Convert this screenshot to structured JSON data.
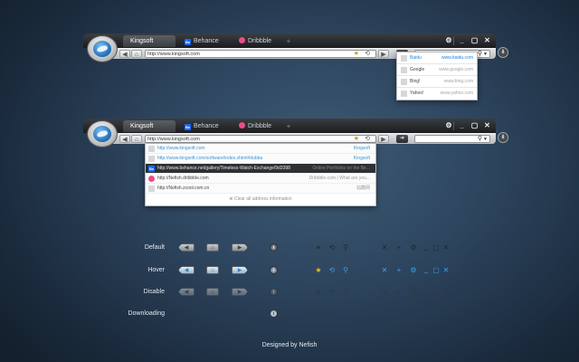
{
  "window1": {
    "tabs": [
      {
        "label": "Kingsoft",
        "icon": "",
        "active": true
      },
      {
        "label": "Behance",
        "icon": "Be",
        "active": false
      },
      {
        "label": "Dribbble",
        "icon": "",
        "active": false
      }
    ],
    "new_tab": "+",
    "controls": [
      "⚙",
      "_",
      "▢",
      "✕"
    ],
    "nav": {
      "back": "◀",
      "forward": "▶",
      "home": "⌂"
    },
    "address": "http://www.kingsoft.com",
    "go_label": "➔",
    "search_engines": [
      {
        "name": "Baidu",
        "url": "www.baidu.com",
        "selected": true
      },
      {
        "name": "Google",
        "url": "www.google.com",
        "selected": false
      },
      {
        "name": "Bing!",
        "url": "www.bing.com",
        "selected": false
      },
      {
        "name": "Yahoo!",
        "url": "www.yahoo.com",
        "selected": false
      }
    ]
  },
  "window2": {
    "tabs": [
      {
        "label": "Kingsoft",
        "icon": "",
        "active": true
      },
      {
        "label": "Behance",
        "icon": "Be",
        "active": false
      },
      {
        "label": "Dribbble",
        "icon": "",
        "active": false
      }
    ],
    "address": "http://www.kingsoft.com",
    "suggestions": [
      {
        "url": "http://www.kingsoft.com",
        "desc": "Kingsoft",
        "style": "blue",
        "icon": ""
      },
      {
        "url": "http://www.kingsoft.com/software/index.shtml#dubba",
        "desc": "Kingsoft",
        "style": "blue",
        "icon": ""
      },
      {
        "url": "http://www.behance.net/gallery/Timeless-Watch-Exchange/9d3398",
        "desc": "Online Portfolios on the Be...",
        "style": "hl",
        "icon": "Be"
      },
      {
        "url": "http://Nefish.dribbble.com",
        "desc": "Dribbble.com | What are you...",
        "style": "",
        "icon": ""
      },
      {
        "url": "http://Nefish.zcool.com.cn",
        "desc": "站酷网",
        "style": "",
        "icon": ""
      }
    ],
    "clear_label": "Clear all address information"
  },
  "states": {
    "default": "Default",
    "hover": "Hover",
    "disable": "Disable",
    "downloading": "Downloading"
  },
  "glyphs": {
    "back": "◀",
    "home": "⌂",
    "forward": "▶",
    "download": "⬇",
    "star": "★",
    "refresh": "⟲",
    "search": "⚲",
    "close": "✕",
    "plus": "+",
    "gear": "⚙",
    "min": "_",
    "max": "▢"
  },
  "colors": {
    "accent": "#3e93d6",
    "hover_star": "#f2c219"
  },
  "credit": "Designed by Nefish"
}
